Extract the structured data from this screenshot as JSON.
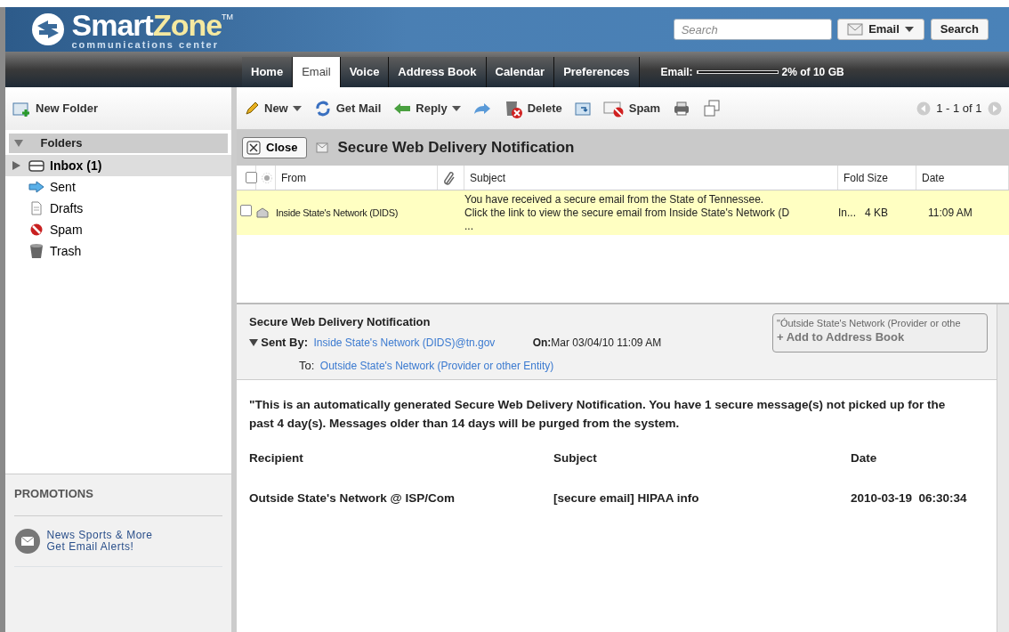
{
  "header": {
    "logo": {
      "name_a": "Smart",
      "name_b": "Zone",
      "mark": "TM",
      "tagline": "communications center"
    },
    "search": {
      "placeholder": "Search"
    },
    "scope": "Email",
    "search_button": "Search"
  },
  "tabs": [
    {
      "label": "Home",
      "selected": false
    },
    {
      "label": "Email",
      "selected": true
    },
    {
      "label": "Voice",
      "selected": false
    },
    {
      "label": "Address Book",
      "selected": false
    },
    {
      "label": "Calendar",
      "selected": false
    },
    {
      "label": "Preferences",
      "selected": false
    }
  ],
  "storage": {
    "label": "Email:",
    "level": 0.02,
    "reading": "2% of 10 GB"
  },
  "sidebar": {
    "new_folder": "New Folder",
    "folders_title": "Folders",
    "folders_expanded": true,
    "folders": [
      {
        "name": "Inbox (1)",
        "kind": "inbox",
        "selected": true
      },
      {
        "name": "Sent",
        "kind": "sent",
        "selected": false
      },
      {
        "name": "Drafts",
        "kind": "drafts",
        "selected": false
      },
      {
        "name": "Spam",
        "kind": "spam",
        "selected": false
      },
      {
        "name": "Trash",
        "kind": "trash",
        "selected": false
      }
    ],
    "promotions_title": "PROMOTIONS",
    "promotion_lines": [
      "News Sports & More",
      "Get Email Alerts!"
    ]
  },
  "toolbar": [
    {
      "kind": "new",
      "label": "New",
      "caret": true
    },
    {
      "kind": "getmail",
      "label": "Get Mail",
      "caret": false
    },
    {
      "kind": "reply",
      "label": "Reply",
      "caret": true
    },
    {
      "kind": "forward",
      "caret": false
    },
    {
      "kind": "delete",
      "label": "Delete",
      "caret": false
    },
    {
      "kind": "move",
      "caret": false
    },
    {
      "kind": "spam",
      "label": "Spam",
      "caret": false
    },
    {
      "kind": "print",
      "caret": false
    },
    {
      "kind": "popout",
      "caret": false
    }
  ],
  "pager": "1 - 1 of 1",
  "message_header": {
    "close": "Close",
    "title": "Secure Web Delivery Notification"
  },
  "list": {
    "select_all_checked": false,
    "columns": [
      "From",
      "Subject",
      "Fold",
      "Size",
      "Date"
    ],
    "rows": [
      {
        "checked": false,
        "selected": true,
        "from": "Inside State's Network (DIDS)",
        "subject_lines": [
          "You have received a secure email from the State of Tennessee.",
          "Click the link to view the secure email from Inside State's Network (D",
          "..."
        ],
        "folder": "In...",
        "size": "4 KB",
        "date": "11:09 AM"
      }
    ]
  },
  "preview": {
    "subject": "Secure Web Delivery Notification",
    "sent_by_label": "Sent By:",
    "sent_by": "Inside State's Network (DIDS)@tn.gov",
    "on_label": "On:",
    "on_value": "Mar 03/04/10 11:09 AM",
    "to_label": "To:",
    "to": "Outside State's Network (Provider or other Entity)",
    "contact": "\"Óutside State's Network (Provider or othe",
    "add_contact": "+ Add to Address Book",
    "body": "\"This is an automatically generated Secure Web Delivery Notification. You have 1 secure message(s) not picked up for the past 4 day(s). Messages older than 14 days will be purged from the system.",
    "table": {
      "columns": [
        "Recipient",
        "Subject",
        "Date"
      ],
      "rows": [
        [
          "Outside State's Network @ ISP/Com",
          "[secure email] HIPAA info",
          "2010-03-19  06:30:34"
        ]
      ]
    }
  }
}
